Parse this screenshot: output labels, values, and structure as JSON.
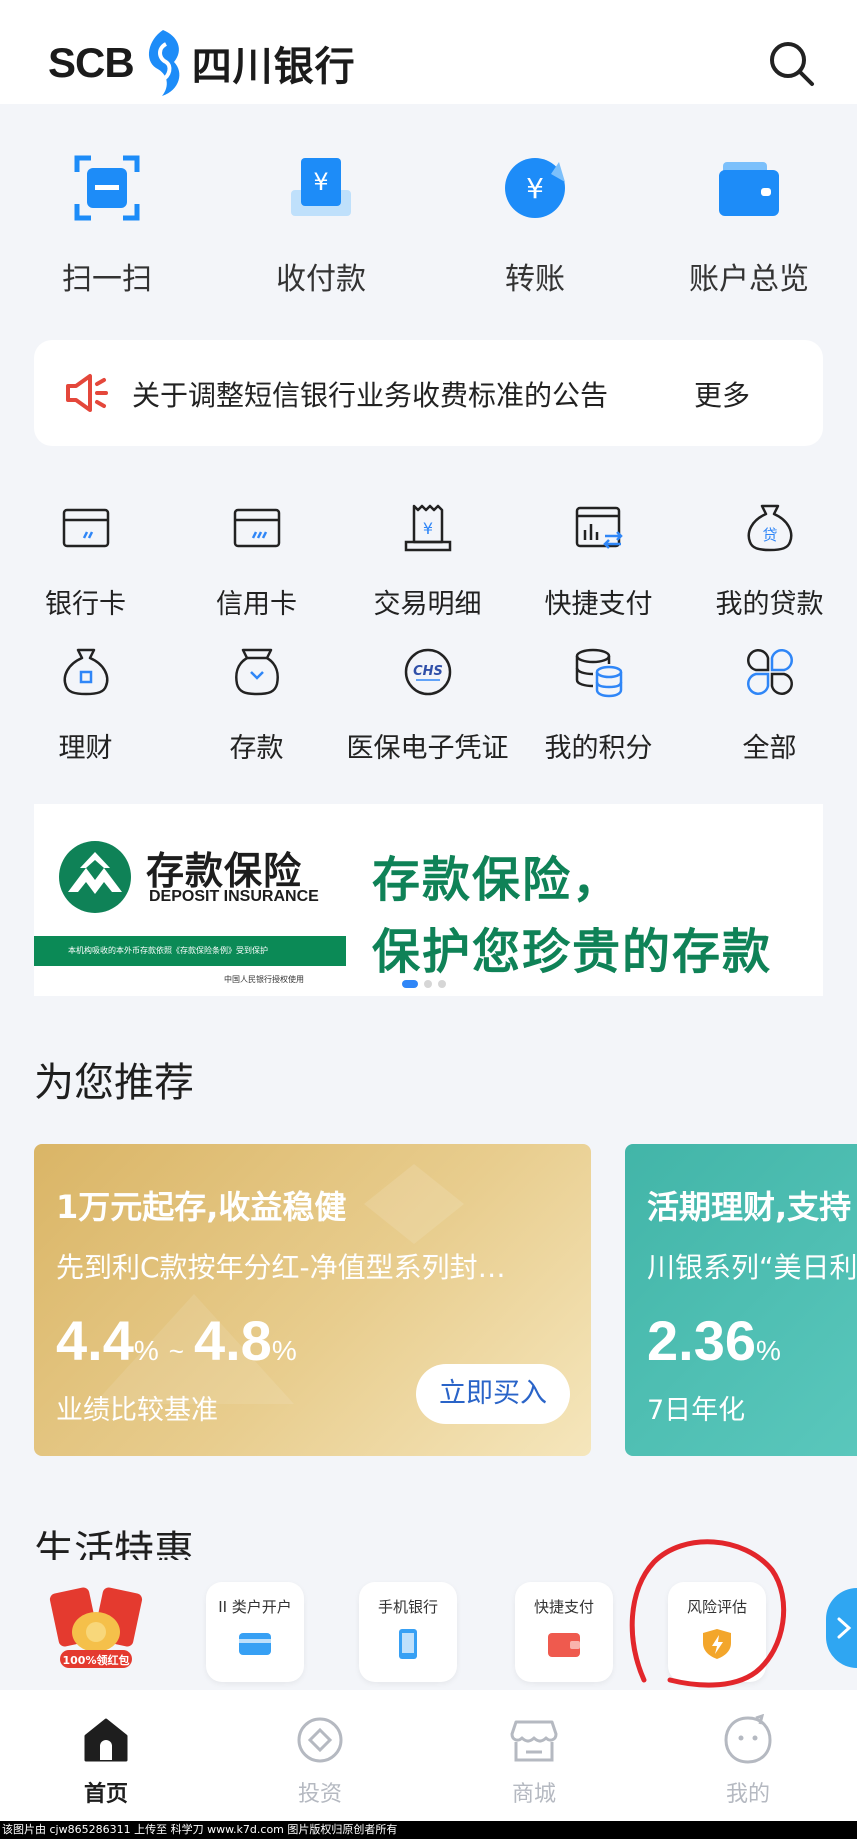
{
  "header": {
    "logo_text": "SCB",
    "logo_cn": "四川银行",
    "search_icon": "search-icon"
  },
  "quick_actions": [
    {
      "label": "扫一扫",
      "icon": "scan-icon"
    },
    {
      "label": "收付款",
      "icon": "receive-pay-icon"
    },
    {
      "label": "转账",
      "icon": "transfer-icon"
    },
    {
      "label": "账户总览",
      "icon": "wallet-icon"
    }
  ],
  "notice": {
    "icon": "megaphone-icon",
    "text": "关于调整短信银行业务收费标准的公告",
    "more": "更多"
  },
  "services": [
    {
      "label": "银行卡",
      "icon": "bank-card-icon"
    },
    {
      "label": "信用卡",
      "icon": "credit-card-icon"
    },
    {
      "label": "交易明细",
      "icon": "receipt-icon"
    },
    {
      "label": "快捷支付",
      "icon": "quick-pay-icon"
    },
    {
      "label": "我的贷款",
      "icon": "loan-bag-icon"
    },
    {
      "label": "理财",
      "icon": "wealth-bag-icon"
    },
    {
      "label": "存款",
      "icon": "deposit-jar-icon"
    },
    {
      "label": "医保电子凭证",
      "icon": "chs-icon"
    },
    {
      "label": "我的积分",
      "icon": "points-coins-icon"
    },
    {
      "label": "全部",
      "icon": "all-grid-icon"
    }
  ],
  "banner": {
    "logo_title": "存款保险",
    "logo_title_en": "DEPOSIT INSURANCE",
    "strip_text": "本机构吸收的本外币存款依照《存款保险条例》受到保护",
    "authorized_text": "中国人民银行授权使用",
    "slogan_line1": "存款保险，",
    "slogan_line2": "保护您珍贵的存款",
    "page_count": 3,
    "active_page": 1
  },
  "recommend": {
    "title": "为您推荐",
    "cards": [
      {
        "title": "1万元起存,收益稳健",
        "subtitle": "先到利C款按年分红-净值型系列封…",
        "rate_low": "4.4",
        "rate_low_unit": "%",
        "rate_sep": "~",
        "rate_high": "4.8",
        "rate_high_unit": "%",
        "note": "业绩比较基准",
        "button": "立即买入"
      },
      {
        "title": "活期理财,支持",
        "subtitle": "川银系列“美日利",
        "rate": "2.36",
        "rate_unit": "%",
        "note": "7日年化"
      }
    ]
  },
  "life": {
    "title": "生活特惠",
    "redpack_label": "100%领红包",
    "promos": [
      {
        "label": "II 类户开户",
        "icon": "card-icon"
      },
      {
        "label": "手机银行",
        "icon": "phone-icon"
      },
      {
        "label": "快捷支付",
        "icon": "wallet-icon"
      },
      {
        "label": "风险评估",
        "icon": "shield-bolt-icon"
      }
    ],
    "next_icon": "chevron-right-icon"
  },
  "tabbar": [
    {
      "label": "首页",
      "icon": "home-icon",
      "active": true
    },
    {
      "label": "投资",
      "icon": "invest-icon",
      "active": false
    },
    {
      "label": "商城",
      "icon": "store-icon",
      "active": false
    },
    {
      "label": "我的",
      "icon": "profile-icon",
      "active": false
    }
  ],
  "watermark": "该图片由 cjw865286311 上传至 科学刀 www.k7d.com 图片版权归原创者所有",
  "colors": {
    "brand_blue": "#1d8cf8",
    "banner_green": "#0f8257",
    "gold_card": "#dab566",
    "teal_card": "#42b5a8",
    "annotation_red": "#e2262b"
  }
}
